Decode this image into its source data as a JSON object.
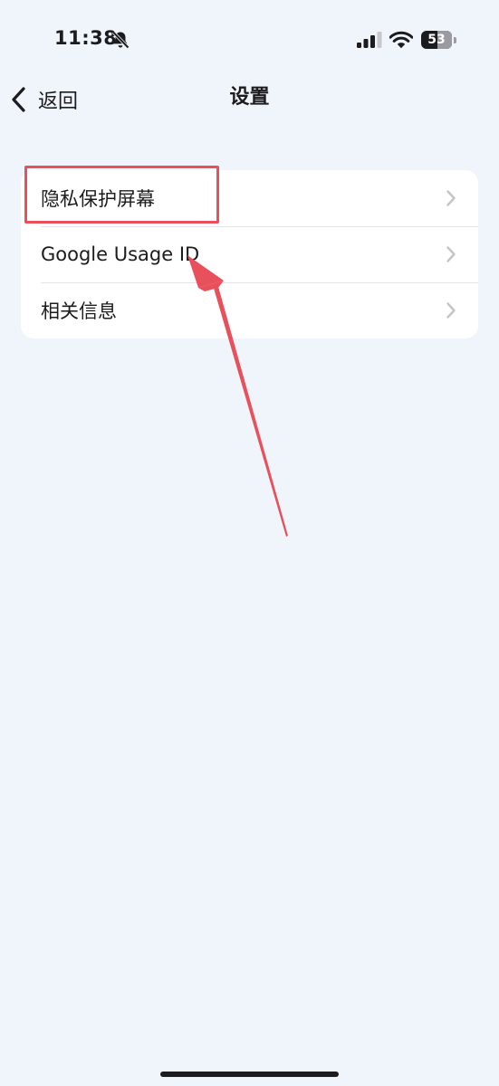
{
  "status_bar": {
    "time": "11:38",
    "battery_level": "53",
    "battery_fraction": 0.53,
    "icons": [
      "bell-slash-icon",
      "cellular-signal-icon",
      "wifi-icon",
      "battery-icon"
    ]
  },
  "nav": {
    "back_label": "返回",
    "title": "设置"
  },
  "settings": {
    "items": [
      {
        "label": "隐私保护屏幕"
      },
      {
        "label": "Google Usage ID"
      },
      {
        "label": "相关信息"
      }
    ]
  },
  "annotation": {
    "color": "#e8505b"
  },
  "colors": {
    "background": "#f0f4fb",
    "card": "#ffffff",
    "text": "#1c1c1e",
    "chevron": "#c4c4c8"
  }
}
